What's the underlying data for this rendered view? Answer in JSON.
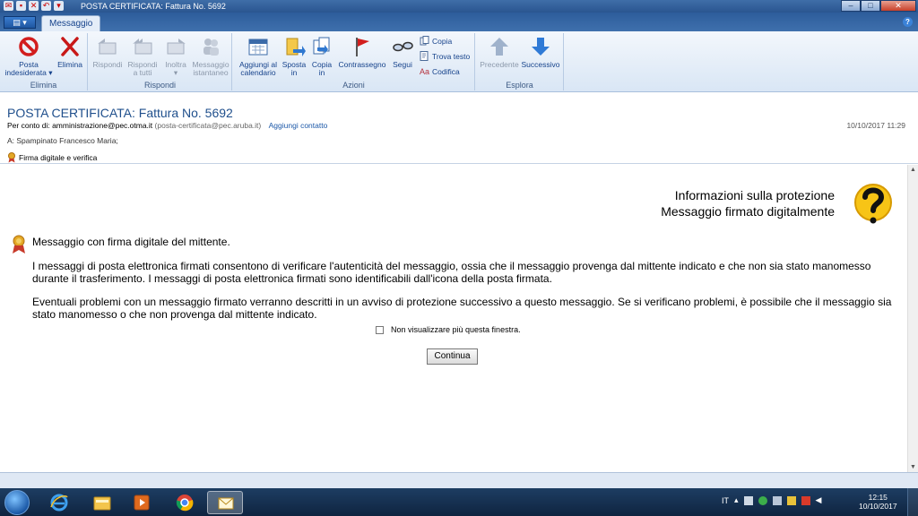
{
  "window": {
    "title": "POSTA CERTIFICATA: Fattura No. 5692"
  },
  "tabs": {
    "active": "Messaggio"
  },
  "ribbon": {
    "groups": {
      "elimina": "Elimina",
      "rispondi": "Rispondi",
      "azioni": "Azioni",
      "esplora": "Esplora"
    },
    "buttons": {
      "posta_indesiderata_1": "Posta",
      "posta_indesiderata_2": "indesiderata",
      "elimina": "Elimina",
      "rispondi": "Rispondi",
      "rispondi_tutti_1": "Rispondi",
      "rispondi_tutti_2": "a tutti",
      "inoltra": "Inoltra",
      "messaggio_istantaneo_1": "Messaggio",
      "messaggio_istantaneo_2": "istantaneo",
      "aggiungi_calendario_1": "Aggiungi al",
      "aggiungi_calendario_2": "calendario",
      "sposta_in_1": "Sposta",
      "sposta_in_2": "in",
      "copia_in_1": "Copia",
      "copia_in_2": "in",
      "contrassegno": "Contrassegno",
      "segui": "Segui",
      "copia": "Copia",
      "trova_testo": "Trova testo",
      "codifica": "Codifica",
      "precedente": "Precedente",
      "successivo": "Successivo"
    }
  },
  "header": {
    "subject": "POSTA CERTIFICATA: Fattura No. 5692",
    "from_prefix": "Per conto di: amministrazione@pec.otma.it",
    "from_address": "(posta-certificata@pec.aruba.it)",
    "add_contact": "Aggiungi contatto",
    "date": "10/10/2017 11:29",
    "to": "A: Spampinato Francesco Maria;",
    "signature": "Firma digitale e verifica"
  },
  "body": {
    "title_line1": "Informazioni sulla protezione",
    "title_line2": "Messaggio firmato digitalmente",
    "p1": "Messaggio con firma digitale del mittente.",
    "p2": "I messaggi di posta elettronica firmati consentono di verificare l'autenticità del messaggio, ossia che il messaggio provenga dal mittente indicato e che non sia stato manomesso durante il trasferimento. I messaggi di posta elettronica firmati sono identificabili dall'icona della posta firmata.",
    "p3": "Eventuali problemi con un messaggio firmato verranno descritti in un avviso di protezione successivo a questo messaggio. Se si verificano problemi, è possibile che il messaggio sia stato manomesso o che non provenga dal mittente indicato.",
    "checkbox_label": "Non visualizzare più questa finestra.",
    "continue_button": "Continua"
  },
  "taskbar": {
    "lang": "IT",
    "time": "12:15",
    "date": "10/10/2017"
  }
}
